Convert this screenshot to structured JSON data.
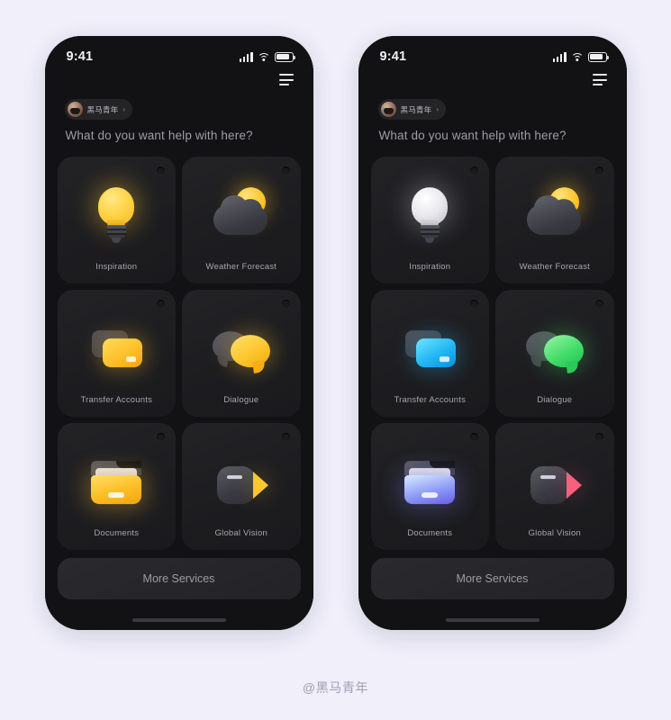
{
  "page": {
    "background_color": "#f0effa",
    "watermark": "@黑马青年"
  },
  "status_bar": {
    "time": "9:41",
    "signal_icon": "cellular-signal-icon",
    "wifi_icon": "wifi-icon",
    "battery_icon": "battery-icon"
  },
  "header": {
    "menu_icon": "hamburger-menu-icon",
    "user_chip": {
      "avatar": "user-avatar",
      "name": "黑马青年",
      "arrow": "›"
    },
    "greeting": "What do you want help with here?"
  },
  "more_services": {
    "label": "More Services"
  },
  "phones": [
    {
      "id": "phone-left",
      "theme": "yellow-accent",
      "accent_color": "#fdc62e",
      "cards": [
        {
          "label": "Inspiration",
          "icon": "lightbulb-icon",
          "variant": "bulb-yellow"
        },
        {
          "label": "Weather Forecast",
          "icon": "cloud-sun-icon",
          "variant": "weather"
        },
        {
          "label": "Transfer Accounts",
          "icon": "credit-cards-icon",
          "variant": "cards-yellow"
        },
        {
          "label": "Dialogue",
          "icon": "speech-bubbles-icon",
          "variant": "chat-yellow"
        },
        {
          "label": "Documents",
          "icon": "folder-icon",
          "variant": "folder-yellow"
        },
        {
          "label": "Global Vision",
          "icon": "video-camera-icon",
          "variant": "cam-yellow"
        }
      ]
    },
    {
      "id": "phone-right",
      "theme": "multicolor-accent",
      "accent_color": "#8e9cf7",
      "cards": [
        {
          "label": "Inspiration",
          "icon": "lightbulb-icon",
          "variant": "bulb-white"
        },
        {
          "label": "Weather Forecast",
          "icon": "cloud-sun-icon",
          "variant": "weather"
        },
        {
          "label": "Transfer Accounts",
          "icon": "credit-cards-icon",
          "variant": "cards-blue"
        },
        {
          "label": "Dialogue",
          "icon": "speech-bubbles-icon",
          "variant": "chat-green"
        },
        {
          "label": "Documents",
          "icon": "folder-icon",
          "variant": "folder-blue"
        },
        {
          "label": "Global Vision",
          "icon": "video-camera-icon",
          "variant": "cam-pink"
        }
      ]
    }
  ]
}
